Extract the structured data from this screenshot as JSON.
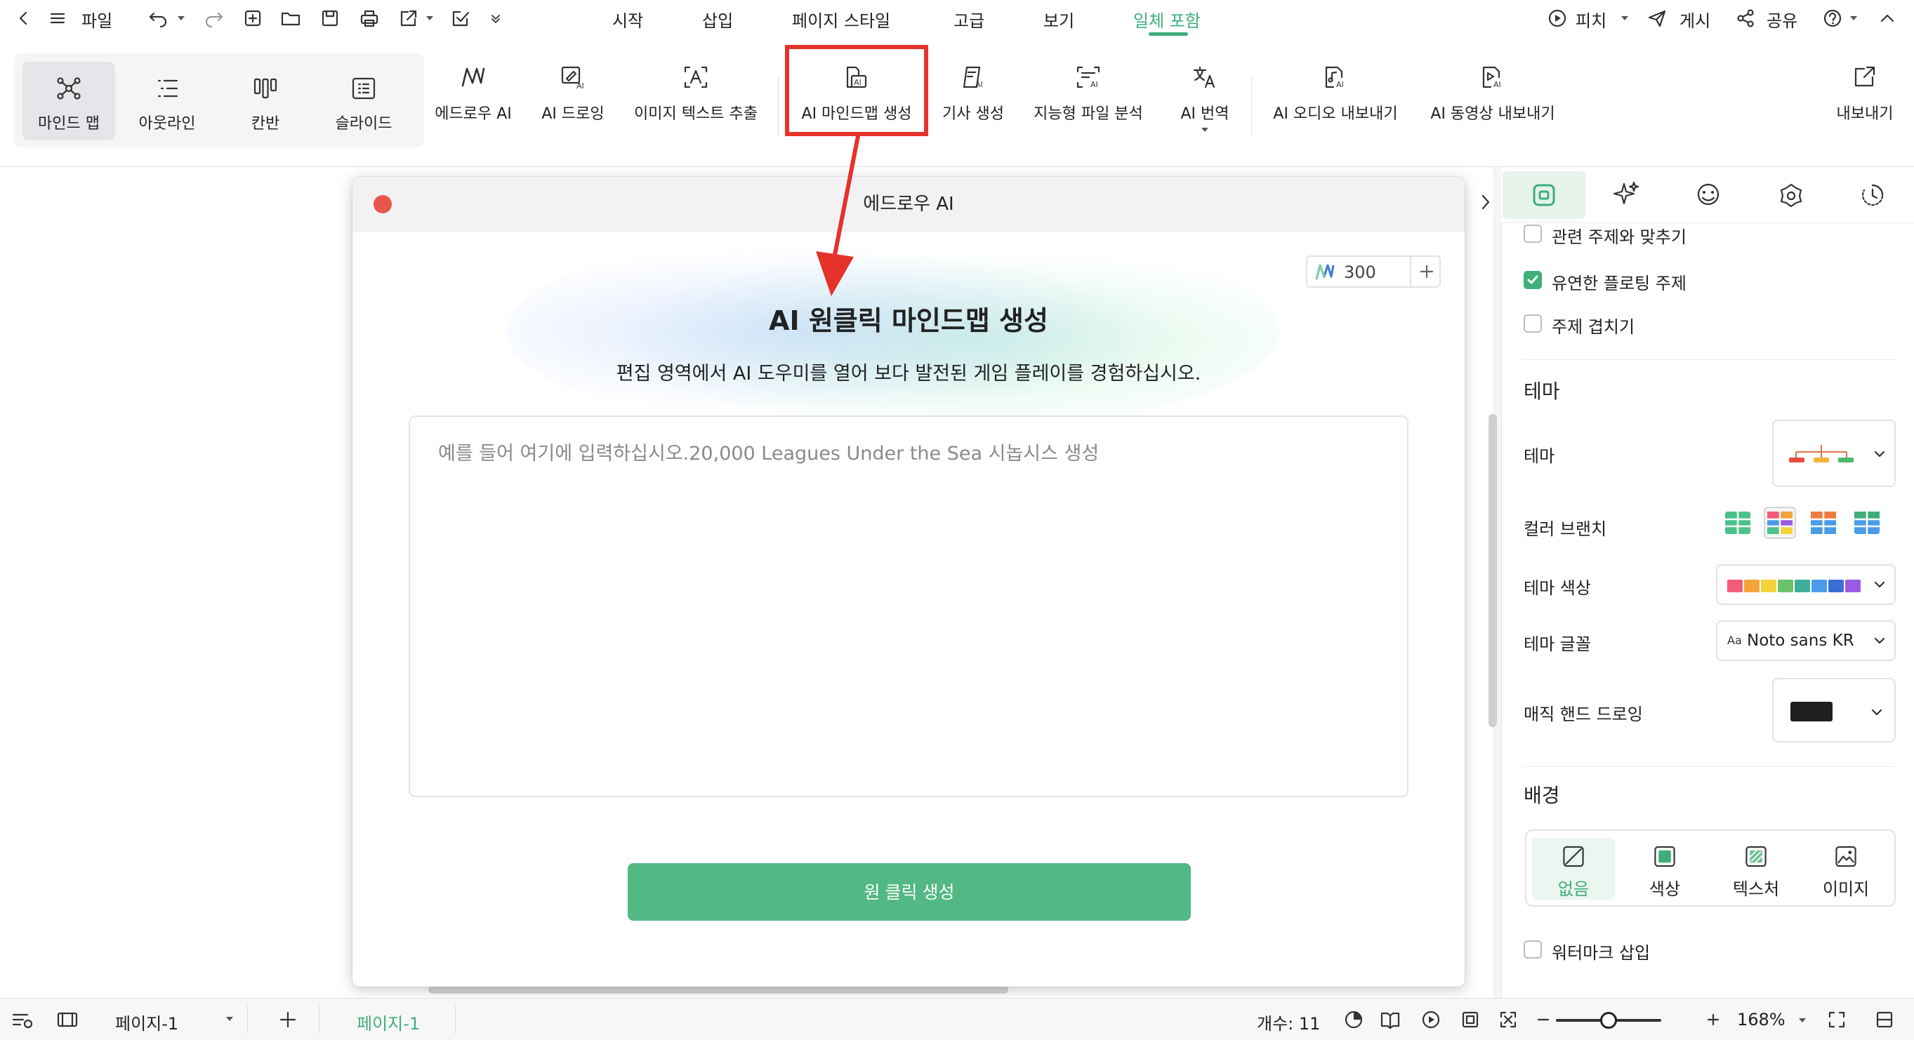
{
  "menubar": {
    "file_label": "파일",
    "tabs": [
      {
        "label": "시작"
      },
      {
        "label": "삽입"
      },
      {
        "label": "페이지 스타일"
      },
      {
        "label": "고급"
      },
      {
        "label": "보기"
      },
      {
        "label": "일체 포함",
        "active": true
      }
    ],
    "right": {
      "pitch": "피치",
      "publish": "게시",
      "share": "공유"
    }
  },
  "ribbon": {
    "views": [
      {
        "label": "마인드 맵",
        "icon": "mindmap-icon",
        "selected": true
      },
      {
        "label": "아웃라인",
        "icon": "outline-icon"
      },
      {
        "label": "칸반",
        "icon": "kanban-icon"
      },
      {
        "label": "슬라이드",
        "icon": "slide-icon"
      }
    ],
    "tools": [
      {
        "label": "에드로우 AI",
        "icon": "edraw-ai-icon"
      },
      {
        "label": "AI 드로잉",
        "icon": "ai-drawing-icon"
      },
      {
        "label": "이미지 텍스트 추출",
        "icon": "image-text-extract-icon"
      },
      {
        "label": "AI 마인드맵 생성",
        "icon": "ai-mindmap-generate-icon",
        "highlighted": true
      },
      {
        "label": "기사 생성",
        "icon": "article-generate-icon"
      },
      {
        "label": "지능형 파일 분석",
        "icon": "file-analysis-icon"
      },
      {
        "label": "AI 번역",
        "icon": "ai-translate-icon"
      },
      {
        "label": "AI 오디오 내보내기",
        "icon": "ai-audio-export-icon"
      },
      {
        "label": "AI 동영상 내보내기",
        "icon": "ai-video-export-icon"
      }
    ],
    "export_label": "내보내기"
  },
  "dialog": {
    "title": "에드로우 AI",
    "credits": "300",
    "heading": "AI 원클릭 마인드맵 생성",
    "subtitle": "편집 영역에서 AI 도우미를 열어 보다 발전된 게임 플레이를 경험하십시오.",
    "placeholder": "예를 들어 여기에 입력하십시오.20,000 Leagues Under the Sea 시놉시스 생성",
    "value": "",
    "generate_label": "원 클릭 생성"
  },
  "panel": {
    "checkboxes": [
      {
        "label": "관련 주제와 맞추기",
        "checked": false
      },
      {
        "label": "유연한 플로팅 주제",
        "checked": true
      },
      {
        "label": "주제 겹치기",
        "checked": false
      }
    ],
    "theme_section": "테마",
    "theme_label": "테마",
    "color_branch_label": "컬러 브랜치",
    "theme_color_label": "테마 색상",
    "theme_colors": [
      "#f25c7a",
      "#f4a33a",
      "#f5d23a",
      "#6cc26a",
      "#3fae9a",
      "#4a9be8",
      "#3b6fd8",
      "#9b5be0"
    ],
    "theme_font_label": "테마 글꼴",
    "theme_font_prefix": "Aa",
    "theme_font_value": "Noto sans KR",
    "magic_hand_label": "매직 핸드 드로잉",
    "background_section": "배경",
    "background_options": [
      {
        "label": "없음",
        "selected": true
      },
      {
        "label": "색상"
      },
      {
        "label": "텍스처"
      },
      {
        "label": "이미지"
      }
    ],
    "watermark_label": "워터마크 삽입"
  },
  "statusbar": {
    "page_select": "페이지-1",
    "page_tab": "페이지-1",
    "count": "개수: 11",
    "zoom": "168%",
    "zoom_fraction": 0.5
  },
  "colors": {
    "accent": "#3fae7a",
    "button": "#52b884",
    "highlight": "#e5322a"
  }
}
